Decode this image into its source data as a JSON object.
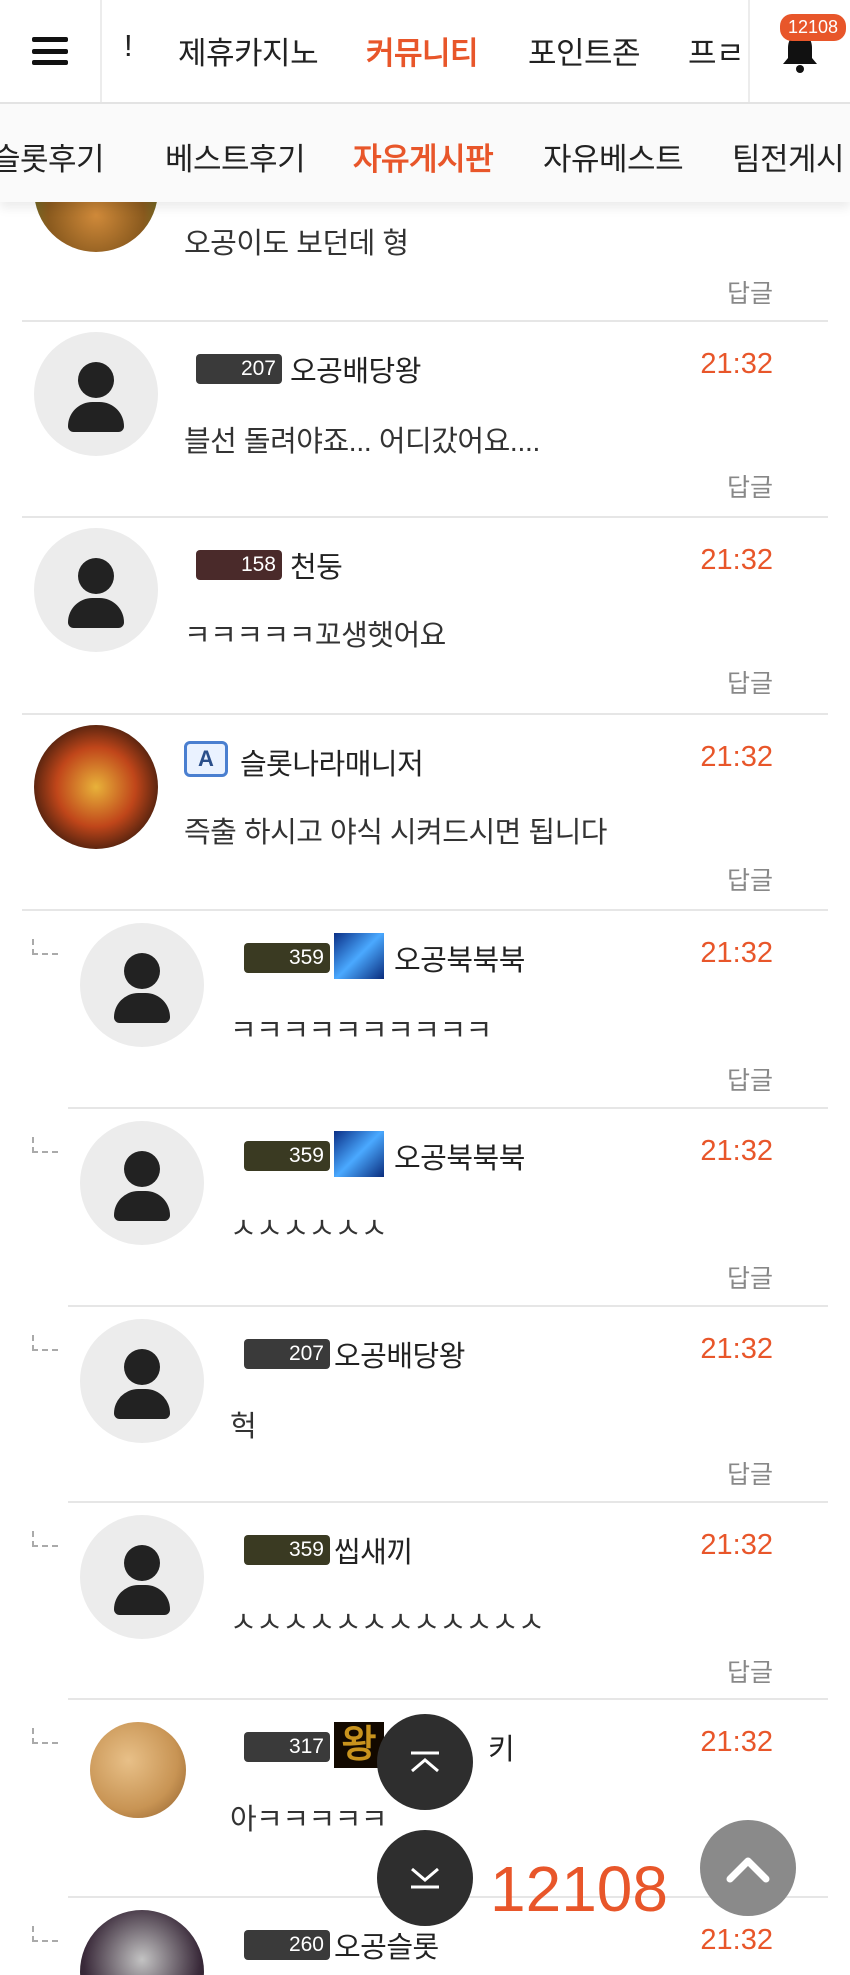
{
  "top_nav": {
    "items": [
      "!",
      "제휴카지노",
      "커뮤니티",
      "포인트존",
      "프ㄹ"
    ],
    "active": "커뮤니티",
    "notification_count": "12108"
  },
  "sub_nav": {
    "items": [
      "슬롯후기",
      "베스트후기",
      "자유게시판",
      "자유베스트",
      "팀전게시"
    ],
    "active": "자유게시판"
  },
  "reply_label": "답글",
  "comments": [
    {
      "nick": "",
      "level": "",
      "time": "",
      "text": "오공이도 보던데 형"
    },
    {
      "nick": "오공배당왕",
      "level": "207",
      "time": "21:32",
      "text": "블선 돌려야죠... 어디갔어요...."
    },
    {
      "nick": "천둥",
      "level": "158",
      "time": "21:32",
      "text": "ㅋㅋㅋㅋㅋ꼬생햇어요"
    },
    {
      "nick": "슬롯나라매니저",
      "level": "",
      "badge": "A",
      "time": "21:32",
      "text": "즉출 하시고 야식 시켜드시면 됩니다"
    },
    {
      "nick": "오공북북북",
      "level": "359",
      "time": "21:32",
      "text": "ㅋㅋㅋㅋㅋㅋㅋㅋㅋㅋ"
    },
    {
      "nick": "오공북북북",
      "level": "359",
      "time": "21:32",
      "text": "ㅅㅅㅅㅅㅅㅅ"
    },
    {
      "nick": "오공배당왕",
      "level": "207",
      "time": "21:32",
      "text": "헉"
    },
    {
      "nick": "씹새끼",
      "level": "359",
      "time": "21:32",
      "text": "ㅅㅅㅅㅅㅅㅅㅅㅅㅅㅅㅅㅅ"
    },
    {
      "nick": "키",
      "level": "317",
      "badge_text": "왕",
      "time": "21:32",
      "text": "아ㅋㅋㅋㅋㅋ"
    },
    {
      "nick": "오공슬롯",
      "level": "260",
      "time": "21:32",
      "text": ""
    }
  ],
  "floating": {
    "point_count": "12108"
  },
  "colors": {
    "accent": "#e8562a",
    "divider": "#e6e6e6",
    "avatar_bg": "#ececec"
  }
}
